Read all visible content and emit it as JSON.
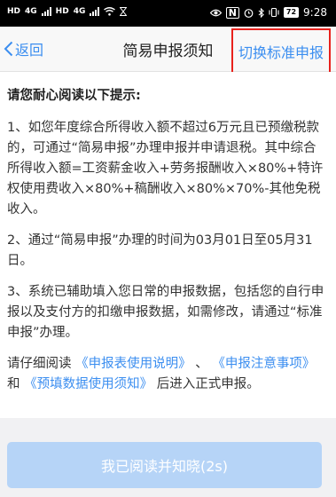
{
  "status_bar": {
    "left_indicators": [
      "HD",
      "4G",
      "HD",
      "4G"
    ],
    "right_icons": [
      "eye-icon",
      "nfc-icon",
      "alarm-icon",
      "bluetooth-icon",
      "vibrate-icon"
    ],
    "battery": "72",
    "time": "9:28"
  },
  "header": {
    "back_label": "返回",
    "title": "简易申报须知",
    "switch_label": "切换标准申报",
    "accent_color": "#3b8ef0",
    "highlight_color": "#e8211c"
  },
  "content": {
    "intro": "请您耐心阅读以下提示:",
    "para1": "1、如您年度综合所得收入额不超过6万元且已预缴税款的，可通过“简易申报”办理申报并申请退税。其中综合所得收入额=工资薪金收入+劳务报酬收入×80%+特许权使用费收入×80%+稿酬收入×80%×70%-其他免税收入。",
    "para2": "2、通过“简易申报”办理的时间为03月01日至05月31日。",
    "para3": "3、系统已辅助填入您日常的申报数据，包括您的自行申报以及支付方的扣缴申报数据，如需修改，请通过“标准申报”办理。",
    "para4": {
      "prefix": "请仔细阅读 ",
      "link1": "《申报表使用说明》",
      "sep1": " 、 ",
      "link2": "《申报注意事项》",
      "sep2": " 和 ",
      "link3": "《预填数据使用须知》",
      "suffix": " 后进入正式申报。"
    }
  },
  "confirm_button": {
    "label": "我已阅读并知晓(2s)"
  }
}
